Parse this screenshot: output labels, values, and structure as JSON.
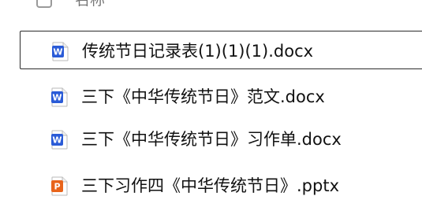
{
  "header": {
    "name_column_label": "名称"
  },
  "files": [
    {
      "name": "传统节日记录表(1)(1)(1).docx",
      "type": "docx",
      "icon": "word-document-icon",
      "icon_letter": "W",
      "icon_color": "#2a5bd7",
      "selected": true
    },
    {
      "name": "三下《中华传统节日》范文.docx",
      "type": "docx",
      "icon": "word-document-icon",
      "icon_letter": "W",
      "icon_color": "#2a5bd7",
      "selected": false
    },
    {
      "name": "三下《中华传统节日》习作单.docx",
      "type": "docx",
      "icon": "word-document-icon",
      "icon_letter": "W",
      "icon_color": "#2a5bd7",
      "selected": false
    },
    {
      "name": "三下习作四《中华传统节日》.pptx",
      "type": "pptx",
      "icon": "powerpoint-document-icon",
      "icon_letter": "P",
      "icon_color": "#e8641b",
      "selected": false
    }
  ],
  "colors": {
    "selection_border": "#2b2b2b",
    "word_blue": "#2a5bd7",
    "ppt_orange": "#e8641b"
  }
}
